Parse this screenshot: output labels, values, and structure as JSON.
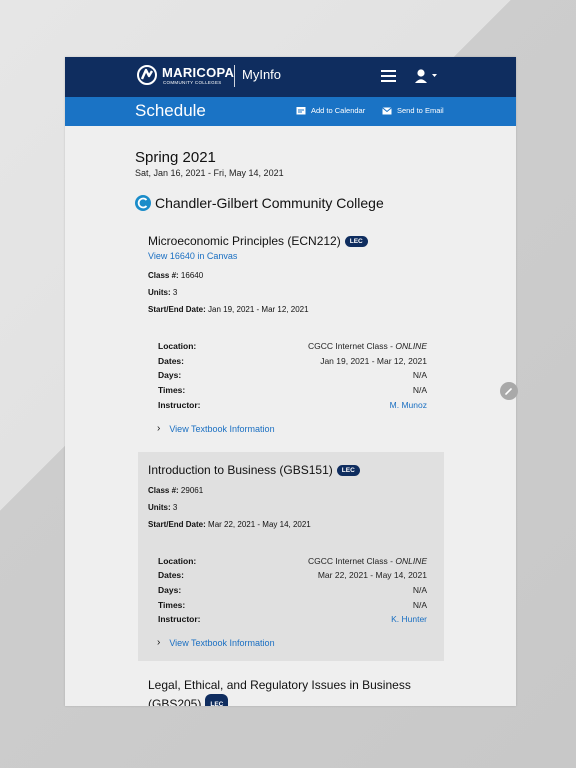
{
  "header": {
    "brand": "MARICOPA",
    "brand_sub": "COMMUNITY COLLEGES",
    "app": "MyInfo",
    "menu_icon": "hamburger-icon",
    "user_icon": "user-icon"
  },
  "subheader": {
    "title": "Schedule",
    "add_calendar": "Add to Calendar",
    "send_email": "Send to Email"
  },
  "term": {
    "title": "Spring 2021",
    "dates": "Sat, Jan 16, 2021 - Fri, May 14, 2021"
  },
  "college": {
    "name": "Chandler-Gilbert Community College"
  },
  "courses": [
    {
      "title": "Microeconomic Principles (ECN212)",
      "badge": "LEC",
      "canvas_link": "View 16640 in Canvas",
      "class_label": "Class #:",
      "class_num": "16640",
      "units_label": "Units:",
      "units": "3",
      "startend_label": "Start/End Date:",
      "startend": "Jan 19, 2021 - Mar 12, 2021",
      "location_label": "Location:",
      "location_prefix": "CGCC Internet Class - ",
      "location_mode": "ONLINE",
      "dates_label": "Dates:",
      "dates": "Jan 19, 2021 - Mar 12, 2021",
      "days_label": "Days:",
      "days": "N/A",
      "times_label": "Times:",
      "times": "N/A",
      "instructor_label": "Instructor:",
      "instructor": "M. Munoz",
      "textbook": "View Textbook Information"
    },
    {
      "title": "Introduction to Business (GBS151)",
      "badge": "LEC",
      "class_label": "Class #:",
      "class_num": "29061",
      "units_label": "Units:",
      "units": "3",
      "startend_label": "Start/End Date:",
      "startend": "Mar 22, 2021 - May 14, 2021",
      "location_label": "Location:",
      "location_prefix": "CGCC Internet Class - ",
      "location_mode": "ONLINE",
      "dates_label": "Dates:",
      "dates": "Mar 22, 2021 - May 14, 2021",
      "days_label": "Days:",
      "days": "N/A",
      "times_label": "Times:",
      "times": "N/A",
      "instructor_label": "Instructor:",
      "instructor": "K. Hunter",
      "textbook": "View Textbook Information"
    },
    {
      "title": "Legal, Ethical, and Regulatory Issues in Business (GBS205)",
      "badge": "LEC"
    }
  ],
  "colors": {
    "header": "#0f2d5f",
    "subheader": "#1a73c5",
    "link": "#1a6fc2",
    "badge": "#0f2d5f"
  }
}
